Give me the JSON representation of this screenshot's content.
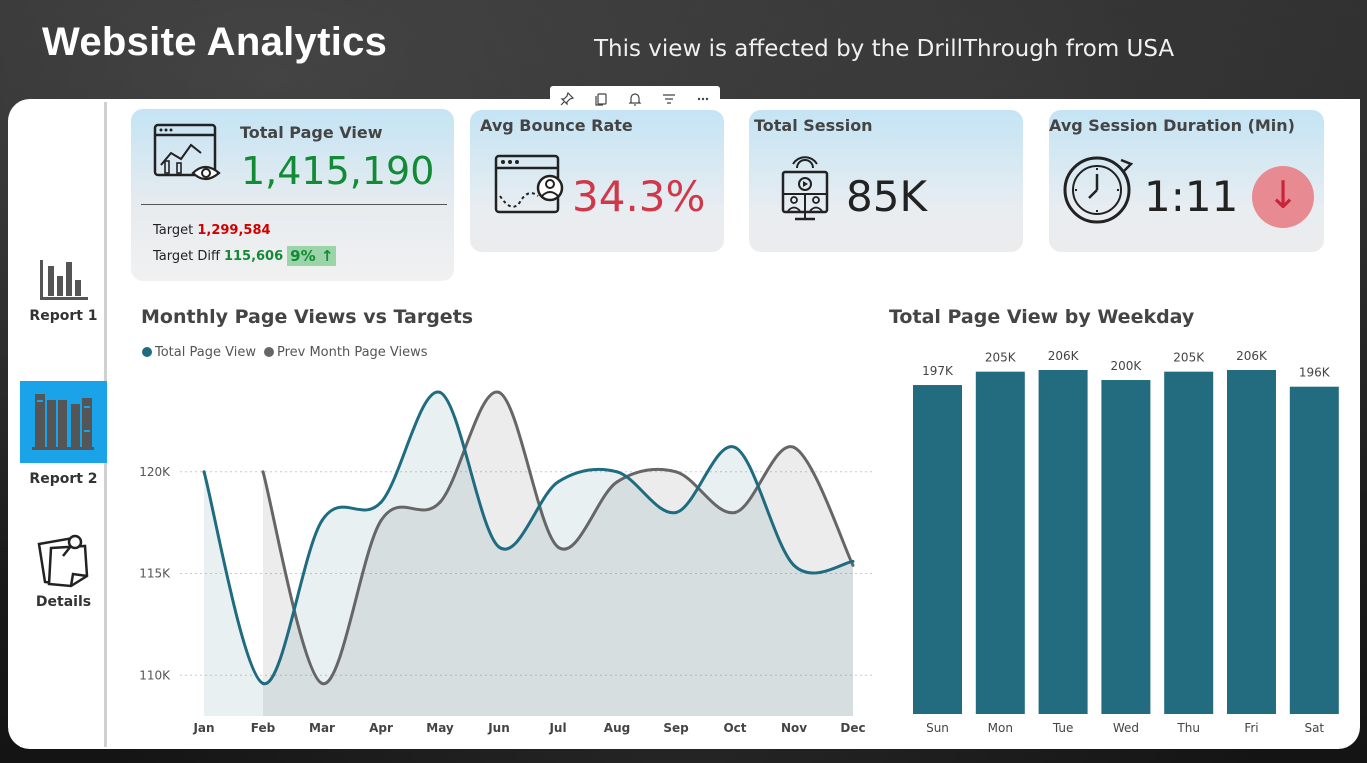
{
  "header": {
    "title": "Website Analytics",
    "subtitle": "This view is affected by the DrillThrough from USA"
  },
  "sidebar": {
    "items": [
      {
        "label": "Report 1",
        "icon": "bar-chart-icon",
        "active": false
      },
      {
        "label": "Report 2",
        "icon": "books-icon",
        "active": true
      },
      {
        "label": "Details",
        "icon": "sticky-note-icon",
        "active": false
      }
    ]
  },
  "toolbar": {
    "icons": [
      "pin-icon",
      "copy-icon",
      "bell-icon",
      "filter-icon",
      "more-icon"
    ]
  },
  "kpis": {
    "total_page_view": {
      "title": "Total Page View",
      "value": "1,415,190",
      "target_label": "Target",
      "target_value": "1,299,584",
      "diff_label": "Target Diff",
      "diff_value": "115,606",
      "diff_pct": "9%",
      "diff_arrow": "↑"
    },
    "avg_bounce_rate": {
      "title": "Avg Bounce Rate",
      "value": "34.3%"
    },
    "total_session": {
      "title": "Total Session",
      "value": "85K"
    },
    "avg_session_duration": {
      "title": "Avg Session Duration (Min)",
      "value": "1:11",
      "trend_arrow": "↓"
    }
  },
  "colors": {
    "teal": "#1f6b80",
    "gray": "#666666",
    "green": "#138a36",
    "red": "#d0384a",
    "highlight": "#1aa3e8"
  },
  "chart_data": [
    {
      "type": "line",
      "title": "Monthly Page Views vs Targets",
      "categories": [
        "Jan",
        "Feb",
        "Mar",
        "Apr",
        "May",
        "Jun",
        "Jul",
        "Aug",
        "Sep",
        "Oct",
        "Nov",
        "Dec"
      ],
      "series": [
        {
          "name": "Total Page View",
          "color": "#1f6b80",
          "values": [
            120000,
            109600,
            117600,
            118500,
            123900,
            116300,
            119500,
            120000,
            118000,
            121200,
            115400,
            115600
          ]
        },
        {
          "name": "Prev Month Page Views",
          "color": "#666666",
          "values": [
            null,
            120000,
            109600,
            117600,
            118500,
            123900,
            116300,
            119500,
            120000,
            118000,
            121200,
            115400
          ]
        }
      ],
      "yticks": [
        "110K",
        "115K",
        "120K"
      ],
      "ytick_values": [
        110000,
        115000,
        120000
      ],
      "ylim": [
        108000,
        125000
      ],
      "legend": "top-left",
      "grid": true
    },
    {
      "type": "bar",
      "title": "Total Page View by Weekday",
      "categories": [
        "Sun",
        "Mon",
        "Tue",
        "Wed",
        "Thu",
        "Fri",
        "Sat"
      ],
      "values": [
        197000,
        205000,
        206000,
        200000,
        205000,
        206000,
        196000
      ],
      "data_labels": [
        "197K",
        "205K",
        "206K",
        "200K",
        "205K",
        "206K",
        "196K"
      ],
      "color": "#236b7e",
      "ylim": [
        0,
        206000
      ]
    }
  ]
}
